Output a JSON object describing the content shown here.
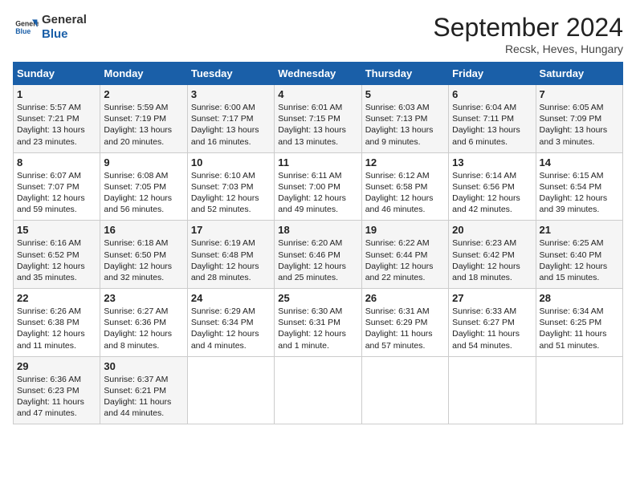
{
  "header": {
    "logo_line1": "General",
    "logo_line2": "Blue",
    "month": "September 2024",
    "location": "Recsk, Heves, Hungary"
  },
  "days_of_week": [
    "Sunday",
    "Monday",
    "Tuesday",
    "Wednesday",
    "Thursday",
    "Friday",
    "Saturday"
  ],
  "weeks": [
    [
      {
        "day": 1,
        "info": "Sunrise: 5:57 AM\nSunset: 7:21 PM\nDaylight: 13 hours\nand 23 minutes."
      },
      {
        "day": 2,
        "info": "Sunrise: 5:59 AM\nSunset: 7:19 PM\nDaylight: 13 hours\nand 20 minutes."
      },
      {
        "day": 3,
        "info": "Sunrise: 6:00 AM\nSunset: 7:17 PM\nDaylight: 13 hours\nand 16 minutes."
      },
      {
        "day": 4,
        "info": "Sunrise: 6:01 AM\nSunset: 7:15 PM\nDaylight: 13 hours\nand 13 minutes."
      },
      {
        "day": 5,
        "info": "Sunrise: 6:03 AM\nSunset: 7:13 PM\nDaylight: 13 hours\nand 9 minutes."
      },
      {
        "day": 6,
        "info": "Sunrise: 6:04 AM\nSunset: 7:11 PM\nDaylight: 13 hours\nand 6 minutes."
      },
      {
        "day": 7,
        "info": "Sunrise: 6:05 AM\nSunset: 7:09 PM\nDaylight: 13 hours\nand 3 minutes."
      }
    ],
    [
      {
        "day": 8,
        "info": "Sunrise: 6:07 AM\nSunset: 7:07 PM\nDaylight: 12 hours\nand 59 minutes."
      },
      {
        "day": 9,
        "info": "Sunrise: 6:08 AM\nSunset: 7:05 PM\nDaylight: 12 hours\nand 56 minutes."
      },
      {
        "day": 10,
        "info": "Sunrise: 6:10 AM\nSunset: 7:03 PM\nDaylight: 12 hours\nand 52 minutes."
      },
      {
        "day": 11,
        "info": "Sunrise: 6:11 AM\nSunset: 7:00 PM\nDaylight: 12 hours\nand 49 minutes."
      },
      {
        "day": 12,
        "info": "Sunrise: 6:12 AM\nSunset: 6:58 PM\nDaylight: 12 hours\nand 46 minutes."
      },
      {
        "day": 13,
        "info": "Sunrise: 6:14 AM\nSunset: 6:56 PM\nDaylight: 12 hours\nand 42 minutes."
      },
      {
        "day": 14,
        "info": "Sunrise: 6:15 AM\nSunset: 6:54 PM\nDaylight: 12 hours\nand 39 minutes."
      }
    ],
    [
      {
        "day": 15,
        "info": "Sunrise: 6:16 AM\nSunset: 6:52 PM\nDaylight: 12 hours\nand 35 minutes."
      },
      {
        "day": 16,
        "info": "Sunrise: 6:18 AM\nSunset: 6:50 PM\nDaylight: 12 hours\nand 32 minutes."
      },
      {
        "day": 17,
        "info": "Sunrise: 6:19 AM\nSunset: 6:48 PM\nDaylight: 12 hours\nand 28 minutes."
      },
      {
        "day": 18,
        "info": "Sunrise: 6:20 AM\nSunset: 6:46 PM\nDaylight: 12 hours\nand 25 minutes."
      },
      {
        "day": 19,
        "info": "Sunrise: 6:22 AM\nSunset: 6:44 PM\nDaylight: 12 hours\nand 22 minutes."
      },
      {
        "day": 20,
        "info": "Sunrise: 6:23 AM\nSunset: 6:42 PM\nDaylight: 12 hours\nand 18 minutes."
      },
      {
        "day": 21,
        "info": "Sunrise: 6:25 AM\nSunset: 6:40 PM\nDaylight: 12 hours\nand 15 minutes."
      }
    ],
    [
      {
        "day": 22,
        "info": "Sunrise: 6:26 AM\nSunset: 6:38 PM\nDaylight: 12 hours\nand 11 minutes."
      },
      {
        "day": 23,
        "info": "Sunrise: 6:27 AM\nSunset: 6:36 PM\nDaylight: 12 hours\nand 8 minutes."
      },
      {
        "day": 24,
        "info": "Sunrise: 6:29 AM\nSunset: 6:34 PM\nDaylight: 12 hours\nand 4 minutes."
      },
      {
        "day": 25,
        "info": "Sunrise: 6:30 AM\nSunset: 6:31 PM\nDaylight: 12 hours\nand 1 minute."
      },
      {
        "day": 26,
        "info": "Sunrise: 6:31 AM\nSunset: 6:29 PM\nDaylight: 11 hours\nand 57 minutes."
      },
      {
        "day": 27,
        "info": "Sunrise: 6:33 AM\nSunset: 6:27 PM\nDaylight: 11 hours\nand 54 minutes."
      },
      {
        "day": 28,
        "info": "Sunrise: 6:34 AM\nSunset: 6:25 PM\nDaylight: 11 hours\nand 51 minutes."
      }
    ],
    [
      {
        "day": 29,
        "info": "Sunrise: 6:36 AM\nSunset: 6:23 PM\nDaylight: 11 hours\nand 47 minutes."
      },
      {
        "day": 30,
        "info": "Sunrise: 6:37 AM\nSunset: 6:21 PM\nDaylight: 11 hours\nand 44 minutes."
      },
      null,
      null,
      null,
      null,
      null
    ]
  ]
}
